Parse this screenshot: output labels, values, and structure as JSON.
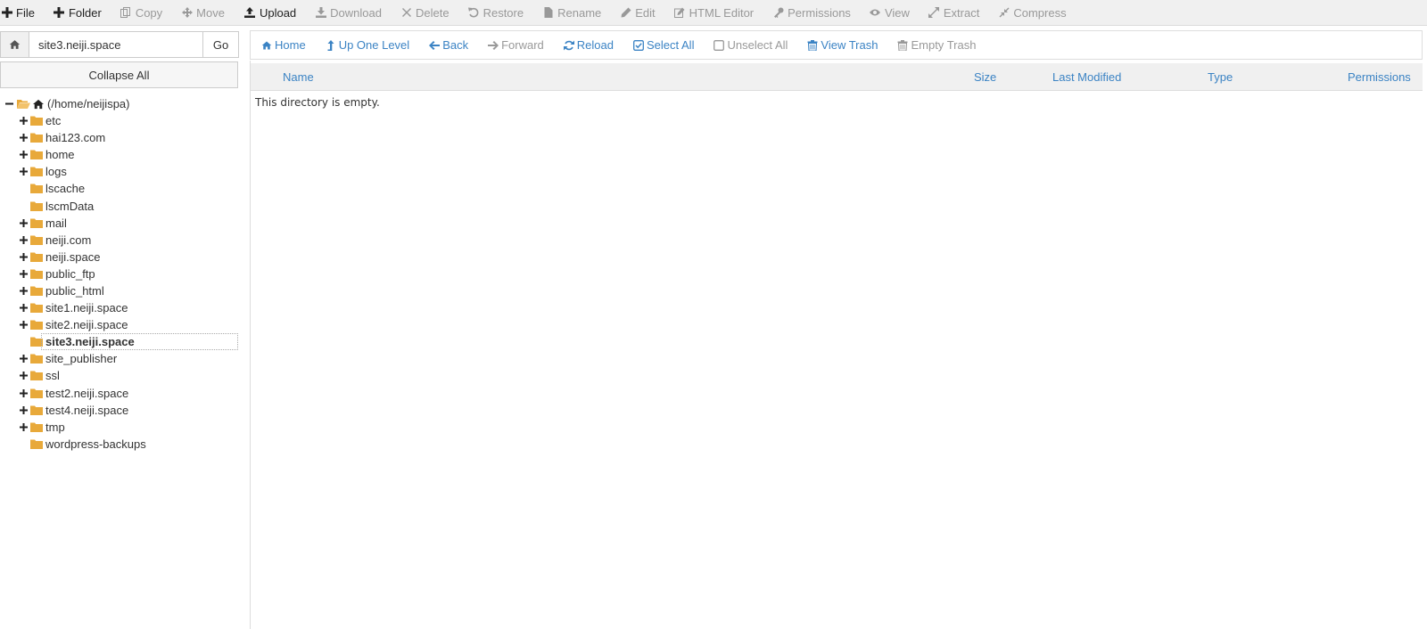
{
  "toolbar": {
    "buttons": [
      {
        "label": "File",
        "icon": "plus-icon",
        "enabled": true
      },
      {
        "label": "Folder",
        "icon": "plus-icon",
        "enabled": true
      },
      {
        "label": "Copy",
        "icon": "copy-icon",
        "enabled": false
      },
      {
        "label": "Move",
        "icon": "move-icon",
        "enabled": false
      },
      {
        "label": "Upload",
        "icon": "upload-icon",
        "enabled": true
      },
      {
        "label": "Download",
        "icon": "download-icon",
        "enabled": false
      },
      {
        "label": "Delete",
        "icon": "times-icon",
        "enabled": false
      },
      {
        "label": "Restore",
        "icon": "undo-icon",
        "enabled": false
      },
      {
        "label": "Rename",
        "icon": "file-icon",
        "enabled": false
      },
      {
        "label": "Edit",
        "icon": "pencil-icon",
        "enabled": false
      },
      {
        "label": "HTML Editor",
        "icon": "edit-icon",
        "enabled": false
      },
      {
        "label": "Permissions",
        "icon": "key-icon",
        "enabled": false
      },
      {
        "label": "View",
        "icon": "eye-icon",
        "enabled": false
      },
      {
        "label": "Extract",
        "icon": "expand-icon",
        "enabled": false
      },
      {
        "label": "Compress",
        "icon": "compress-icon",
        "enabled": false
      }
    ]
  },
  "sidebar": {
    "path_value": "site3.neiji.space",
    "go_label": "Go",
    "collapse_label": "Collapse All",
    "root_label": "(/home/neijispa)",
    "items": [
      {
        "label": "etc",
        "expandable": true
      },
      {
        "label": "hai123.com",
        "expandable": true
      },
      {
        "label": "home",
        "expandable": true
      },
      {
        "label": "logs",
        "expandable": true
      },
      {
        "label": "lscache",
        "expandable": false
      },
      {
        "label": "lscmData",
        "expandable": false
      },
      {
        "label": "mail",
        "expandable": true
      },
      {
        "label": "neiji.com",
        "expandable": true
      },
      {
        "label": "neiji.space",
        "expandable": true
      },
      {
        "label": "public_ftp",
        "expandable": true
      },
      {
        "label": "public_html",
        "expandable": true
      },
      {
        "label": "site1.neiji.space",
        "expandable": true
      },
      {
        "label": "site2.neiji.space",
        "expandable": true
      },
      {
        "label": "site3.neiji.space",
        "expandable": false,
        "selected": true
      },
      {
        "label": "site_publisher",
        "expandable": true
      },
      {
        "label": "ssl",
        "expandable": true
      },
      {
        "label": "test2.neiji.space",
        "expandable": true
      },
      {
        "label": "test4.neiji.space",
        "expandable": true
      },
      {
        "label": "tmp",
        "expandable": true
      },
      {
        "label": "wordpress-backups",
        "expandable": false
      }
    ]
  },
  "nav": {
    "buttons": [
      {
        "label": "Home",
        "icon": "home-icon",
        "enabled": true
      },
      {
        "label": "Up One Level",
        "icon": "level-up-icon",
        "enabled": true
      },
      {
        "label": "Back",
        "icon": "arrow-left-icon",
        "enabled": true
      },
      {
        "label": "Forward",
        "icon": "arrow-right-icon",
        "enabled": false
      },
      {
        "label": "Reload",
        "icon": "refresh-icon",
        "enabled": true
      },
      {
        "label": "Select All",
        "icon": "check-square-icon",
        "enabled": true
      },
      {
        "label": "Unselect All",
        "icon": "square-icon",
        "enabled": false
      },
      {
        "label": "View Trash",
        "icon": "trash-icon",
        "enabled": true
      },
      {
        "label": "Empty Trash",
        "icon": "trash-icon",
        "enabled": false
      }
    ]
  },
  "table": {
    "headers": {
      "name": "Name",
      "size": "Size",
      "modified": "Last Modified",
      "type": "Type",
      "permissions": "Permissions"
    },
    "empty_message": "This directory is empty."
  },
  "colors": {
    "link": "#3b83c4",
    "folder": "#e8a93a",
    "disabled": "#999999"
  }
}
